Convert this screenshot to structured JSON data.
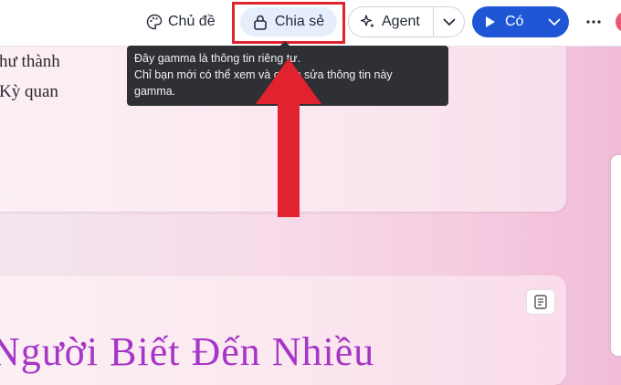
{
  "toolbar": {
    "theme_label": "Chủ đề",
    "share_label": "Chia sẻ",
    "agent_label": "Agent",
    "present_label": "Có"
  },
  "tooltip": {
    "line1": "Đây gamma là thông tin riêng tư.",
    "line2": "Chỉ bạn mới có thể xem và chỉnh sửa thông tin này",
    "line3": "gamma."
  },
  "content": {
    "card1_line1": "hư thành",
    "card1_line2": "Kỳ quan",
    "card2_title": "Người Biết Đến Nhiều"
  },
  "colors": {
    "accent_blue": "#1e56d6",
    "highlight_red": "#e0232e",
    "title_purple": "#a636c6",
    "tooltip_bg": "#2f3035"
  },
  "icons": [
    "palette-icon",
    "lock-icon",
    "sparkle-icon",
    "chevron-down-icon",
    "play-icon",
    "more-icon",
    "notes-icon"
  ]
}
